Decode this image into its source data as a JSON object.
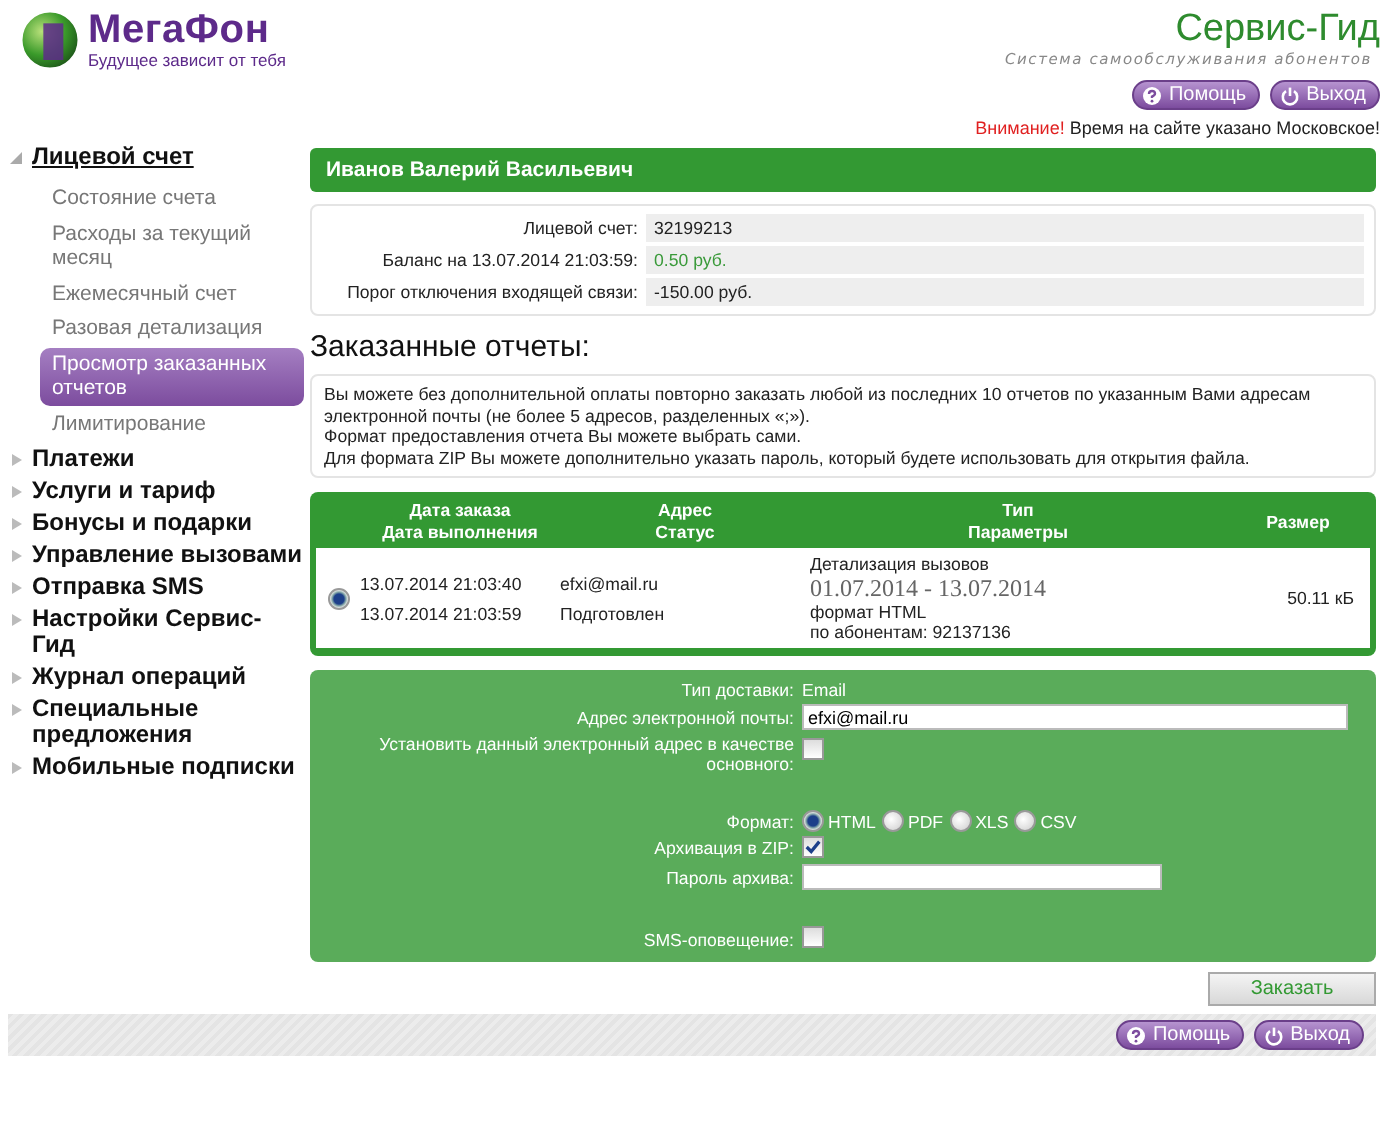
{
  "header": {
    "logo_name": "МегаФон",
    "logo_slogan": "Будущее зависит от тебя",
    "service_title": "Сервис-Гид",
    "service_subtitle": "Система самообслуживания абонентов"
  },
  "top_buttons": [
    {
      "kind": "help",
      "label": "Помощь"
    },
    {
      "kind": "logout",
      "label": "Выход"
    }
  ],
  "notice": {
    "warning": "Внимание!",
    "text": "Время на сайте указано Московское!"
  },
  "sidebar": {
    "items": [
      {
        "label": "Лицевой счет",
        "expanded": true,
        "children": [
          {
            "label": "Состояние счета",
            "selected": false
          },
          {
            "label": "Расходы за текущий месяц",
            "selected": false
          },
          {
            "label": "Ежемесячный счет",
            "selected": false
          },
          {
            "label": "Разовая детализация",
            "selected": false
          },
          {
            "label": "Просмотр заказанных отчетов",
            "selected": true
          },
          {
            "label": "Лимитирование",
            "selected": false
          }
        ]
      },
      {
        "label": "Платежи",
        "expanded": false
      },
      {
        "label": "Услуги и тариф",
        "expanded": false
      },
      {
        "label": "Бонусы и подарки",
        "expanded": false
      },
      {
        "label": "Управление вызовами",
        "expanded": false
      },
      {
        "label": "Отправка SMS",
        "expanded": false
      },
      {
        "label": "Настройки Сервис-Гид",
        "expanded": false
      },
      {
        "label": "Журнал операций",
        "expanded": false
      },
      {
        "label": "Специальные предложения",
        "expanded": false
      },
      {
        "label": "Мобильные подписки",
        "expanded": false
      }
    ]
  },
  "subscriber_name": "Иванов Валерий Васильевич",
  "account": [
    {
      "label": "Лицевой счет:",
      "value": "32199213",
      "kind": "plain"
    },
    {
      "label": "Баланс на 13.07.2014 21:03:59:",
      "value": "0.50 руб.",
      "kind": "positive"
    },
    {
      "label": "Порог отключения входящей связи:",
      "value": "-150.00 руб.",
      "kind": "plain"
    }
  ],
  "section_title": "Заказанные отчеты:",
  "info_lines": [
    "Вы можете без дополнительной оплаты повторно заказать любой из последних 10 отчетов по указанным Вами адресам электронной почты (не более 5 адресов, разделенных «;»).",
    "Формат предоставления отчета Вы можете выбрать сами.",
    "Для формата ZIP Вы можете дополнительно указать пароль, который будете использовать для открытия файла."
  ],
  "reports_table": {
    "columns": [
      {
        "lines": [
          "Дата заказа",
          "Дата выполнения"
        ]
      },
      {
        "lines": [
          "Адрес",
          "Статус"
        ]
      },
      {
        "lines": [
          "Тип",
          "Параметры"
        ]
      },
      {
        "lines": [
          "Размер"
        ]
      }
    ],
    "rows": [
      {
        "selected": true,
        "order_date": "13.07.2014 21:03:40",
        "done_date": "13.07.2014 21:03:59",
        "address": "efxi@mail.ru",
        "status": "Подготовлен",
        "type": "Детализация вызовов",
        "period": "01.07.2014 - 13.07.2014",
        "format": "формат HTML",
        "subscribers": "по абонентам: 92137136",
        "size": "50.11 кБ"
      }
    ]
  },
  "order_form": {
    "delivery_label": "Тип доставки:",
    "delivery_value": "Email",
    "email_label": "Адрес электронной почты:",
    "email_value": "efxi@mail.ru",
    "set_primary": {
      "label": "Установить данный электронный адрес в качестве основного:",
      "checked": false
    },
    "format": {
      "label": "Формат:",
      "options": [
        {
          "label": "HTML",
          "selected": true
        },
        {
          "label": "PDF",
          "selected": false
        },
        {
          "label": "XLS",
          "selected": false
        },
        {
          "label": "CSV",
          "selected": false
        }
      ]
    },
    "zip": {
      "label": "Архивация в ZIP:",
      "checked": true
    },
    "password": {
      "label": "Пароль архива:"
    },
    "sms": {
      "label": "SMS-оповещение:",
      "checked": false
    }
  },
  "submit_button": "Заказать",
  "bottom_buttons": [
    {
      "kind": "help",
      "label": "Помощь"
    },
    {
      "kind": "logout",
      "label": "Выход"
    }
  ]
}
